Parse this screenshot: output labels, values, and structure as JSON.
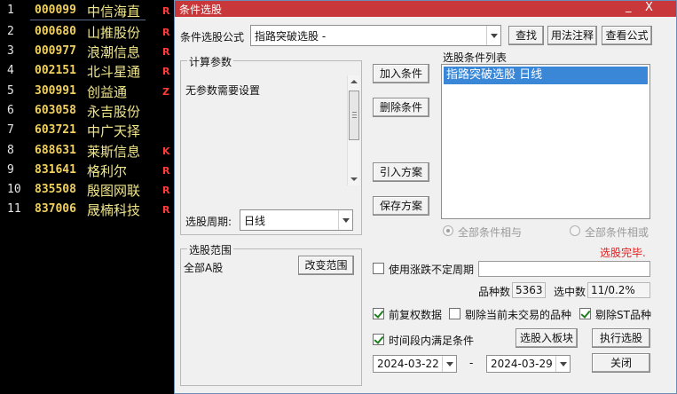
{
  "stock_list": [
    {
      "idx": "1",
      "code": "000099",
      "name": "中信海直",
      "tag": "R"
    },
    {
      "idx": "2",
      "code": "000680",
      "name": "山推股份",
      "tag": "R"
    },
    {
      "idx": "3",
      "code": "000977",
      "name": "浪潮信息",
      "tag": "R"
    },
    {
      "idx": "4",
      "code": "002151",
      "name": "北斗星通",
      "tag": "R"
    },
    {
      "idx": "5",
      "code": "300991",
      "name": "创益通",
      "tag": "Z"
    },
    {
      "idx": "6",
      "code": "603058",
      "name": "永吉股份",
      "tag": ""
    },
    {
      "idx": "7",
      "code": "603721",
      "name": "中广天择",
      "tag": ""
    },
    {
      "idx": "8",
      "code": "688631",
      "name": "莱斯信息",
      "tag": "K"
    },
    {
      "idx": "9",
      "code": "831641",
      "name": "格利尔",
      "tag": "R"
    },
    {
      "idx": "10",
      "code": "835508",
      "name": "殷图网联",
      "tag": "R"
    },
    {
      "idx": "11",
      "code": "837006",
      "name": "晟楠科技",
      "tag": "R"
    }
  ],
  "dialog": {
    "title": "条件选股",
    "minimize": "_",
    "close": "X",
    "formula_label": "条件选股公式",
    "formula_value": "指路突破选股 -",
    "find_button": "查找",
    "usage_button": "用法注释",
    "view_formula_button": "查看公式",
    "params_group": "计算参数",
    "params_text": "无参数需要设置",
    "period_label": "选股周期:",
    "period_value": "日线",
    "add_condition": "加入条件",
    "delete_condition": "删除条件",
    "import_plan": "引入方案",
    "save_plan": "保存方案",
    "condition_list_label": "选股条件列表",
    "condition_list_item": "指路突破选股  日线",
    "radio_and": "全部条件相与",
    "radio_or": "全部条件相或",
    "status": "选股完毕.",
    "range_group": "选股范围",
    "range_value": "全部A股",
    "change_range": "改变范围",
    "use_period_label": "使用涨跌不定周期",
    "count_label": "品种数",
    "count_value": "5363",
    "selected_label": "选中数",
    "selected_value": "11/0.2%",
    "forward_adjust": "前复权数据",
    "exclude_untraded": "剔除当前未交易的品种",
    "exclude_st": "剔除ST品种",
    "time_range_label": "时间段内满足条件",
    "select_to_block": "选股入板块",
    "execute": "执行选股",
    "date_from": "2024-03-22",
    "date_sep": "-",
    "date_to": "2024-03-29",
    "close_button": "关闭"
  },
  "colors": {
    "title_bar": "#c8383a",
    "selection": "#3a87d8",
    "stock_code": "#f0d060",
    "stock_name": "#f0e68c",
    "tag": "#ff3b3b",
    "status": "#e01e1e"
  }
}
